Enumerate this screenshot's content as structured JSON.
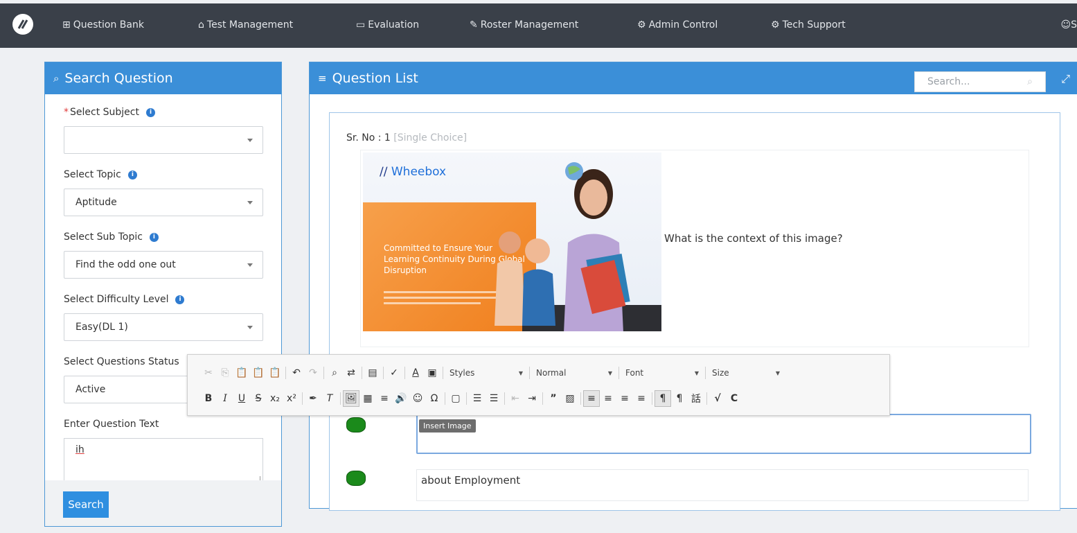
{
  "nav": {
    "items": [
      {
        "label": "Question Bank",
        "icon": "grid-icon"
      },
      {
        "label": "Test Management",
        "icon": "graduation-cap-icon"
      },
      {
        "label": "Evaluation",
        "icon": "laptop-icon"
      },
      {
        "label": "Roster Management",
        "icon": "pencil-icon"
      },
      {
        "label": "Admin Control",
        "icon": "gear-icon"
      },
      {
        "label": "Tech Support",
        "icon": "gear-icon"
      }
    ],
    "user_label": "S"
  },
  "search_panel": {
    "title": "Search Question",
    "subject": {
      "label": "Select Subject",
      "value": ""
    },
    "topic": {
      "label": "Select Topic",
      "value": "Aptitude"
    },
    "sub_topic": {
      "label": "Select Sub Topic",
      "value": "Find the odd one out"
    },
    "difficulty": {
      "label": "Select Difficulty Level",
      "value": "Easy(DL 1)"
    },
    "status": {
      "label": "Select Questions Status",
      "value": "Active"
    },
    "question_text": {
      "label": "Enter Question Text",
      "value": "ih"
    },
    "search_button": "Search"
  },
  "question_list": {
    "title": "Question List",
    "search_placeholder": "Search...",
    "sr_label": "Sr. No : 1",
    "type_label": "[Single Choice]",
    "image_logo": "Wheebox",
    "image_tagline": "Committed to Ensure Your Learning Continuity During Global Disruption",
    "question_text": "What is the context of this image?",
    "options": [
      {
        "text": ""
      },
      {
        "text": "about Employment"
      }
    ]
  },
  "editor_toolbar": {
    "styles_label": "Styles",
    "format_label": "Normal",
    "font_label": "Font",
    "size_label": "Size",
    "tooltip": "Insert Image"
  },
  "colors": {
    "nav_bg": "#3a4049",
    "panel_header": "#3b8fd8",
    "option_marker": "#1b8a1b",
    "required_mark": "#e03c3c"
  }
}
